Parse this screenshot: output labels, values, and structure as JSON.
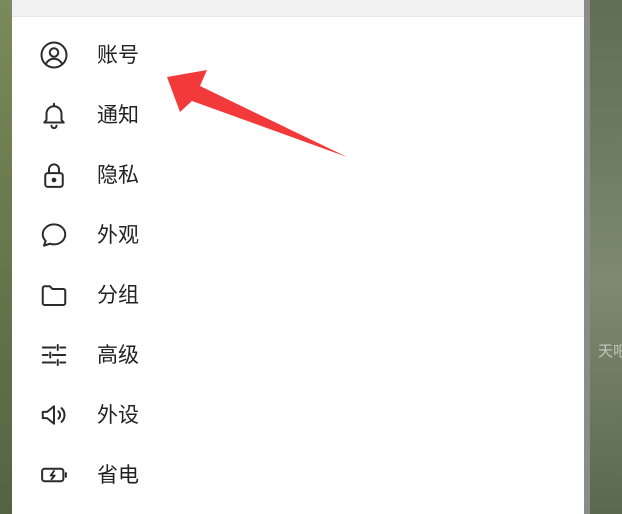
{
  "background": {
    "watermark_text": "天吧"
  },
  "menu": {
    "items": [
      {
        "label": "账号",
        "icon": "account-circle-icon"
      },
      {
        "label": "通知",
        "icon": "bell-icon"
      },
      {
        "label": "隐私",
        "icon": "lock-icon"
      },
      {
        "label": "外观",
        "icon": "chat-bubble-icon"
      },
      {
        "label": "分组",
        "icon": "folder-icon"
      },
      {
        "label": "高级",
        "icon": "sliders-icon"
      },
      {
        "label": "外设",
        "icon": "speaker-icon"
      },
      {
        "label": "省电",
        "icon": "battery-bolt-icon"
      }
    ]
  },
  "colors": {
    "arrow": "#f23a3a",
    "icon_stroke": "#2b2b2b",
    "text": "#222222",
    "panel": "#ffffff"
  }
}
